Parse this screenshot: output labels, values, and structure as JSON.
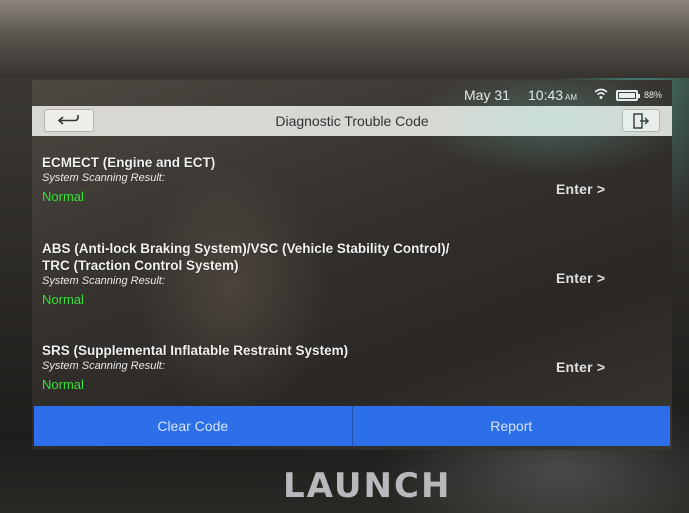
{
  "status_bar": {
    "date": "May 31",
    "time": "10:43",
    "ampm": "AM",
    "battery": "88%",
    "wifi_icon": "wifi-icon",
    "battery_icon": "battery-icon",
    "battery_level": 0.88
  },
  "header": {
    "title": "Diagnostic Trouble Code",
    "back_icon": "back-arrow-icon",
    "exit_icon": "exit-icon"
  },
  "systems": [
    {
      "name_lines": [
        "ECMECT (Engine and ECT)"
      ],
      "scan_label": "System Scanning Result:",
      "status": "Normal",
      "enter_label": "Enter >"
    },
    {
      "name_lines": [
        "ABS (Anti-lock Braking System)/VSC (Vehicle Stability Control)/",
        "TRC (Traction Control System)"
      ],
      "scan_label": "System Scanning Result:",
      "status": "Normal",
      "enter_label": "Enter >"
    },
    {
      "name_lines": [
        "SRS (Supplemental Inflatable Restraint System)"
      ],
      "scan_label": "System Scanning Result:",
      "status": "Normal",
      "enter_label": "Enter >"
    }
  ],
  "footer": {
    "clear_label": "Clear Code",
    "report_label": "Report"
  },
  "brand": "LAUNCH",
  "colors": {
    "accent": "#2c6fe8",
    "status_normal": "#36e036"
  }
}
